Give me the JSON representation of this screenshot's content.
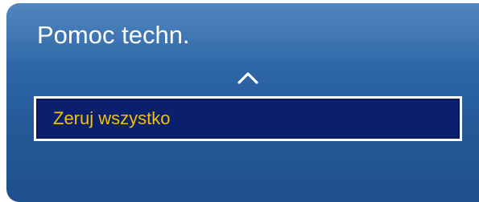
{
  "dialog": {
    "title": "Pomoc techn.",
    "scroll_up_icon": "chevron-up-icon",
    "items": [
      {
        "label": "Zeruj wszystko",
        "selected": true
      }
    ]
  },
  "colors": {
    "panel_top": "#3d78b8",
    "panel_bottom": "#1f4f8c",
    "highlight_bg": "#0a1f6e",
    "highlight_border": "#ffffff",
    "highlight_text": "#f2c200",
    "title_text": "#ffffff"
  }
}
